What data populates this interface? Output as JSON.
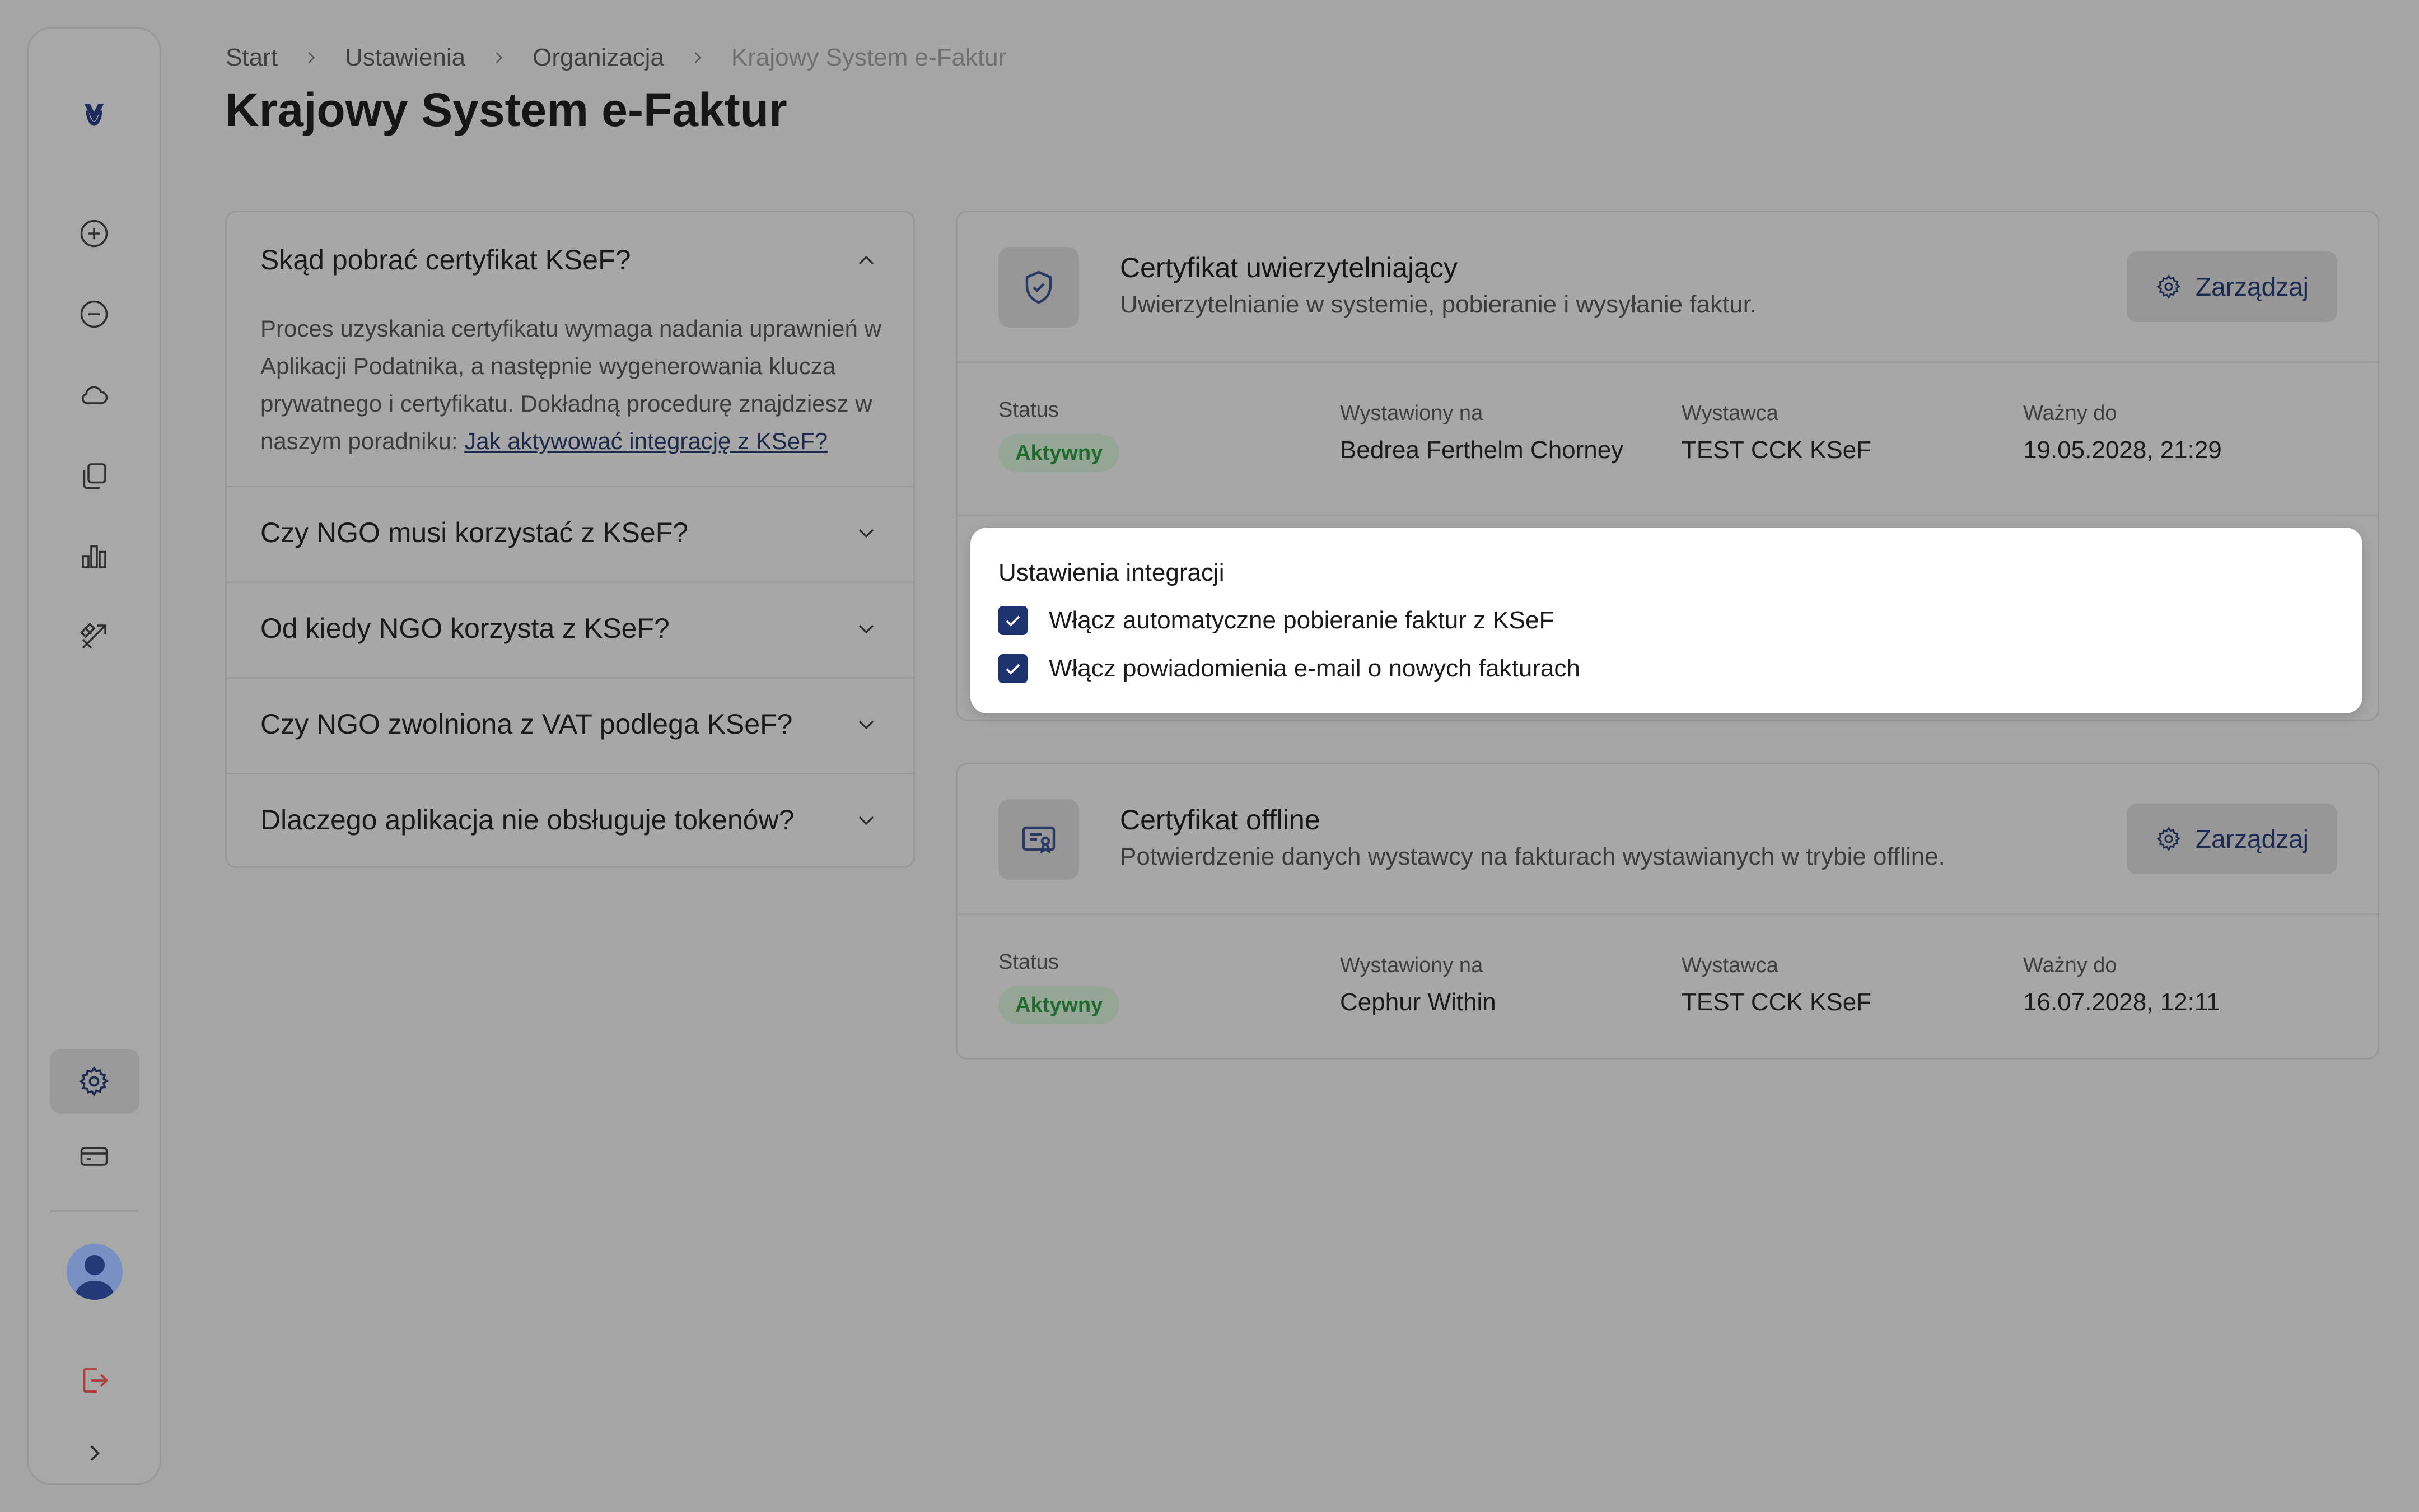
{
  "breadcrumb": {
    "items": [
      "Start",
      "Ustawienia",
      "Organizacja"
    ],
    "current": "Krajowy System e-Faktur"
  },
  "page": {
    "title": "Krajowy System e-Faktur"
  },
  "sidebar": {
    "icons": [
      "logo-icon",
      "plus-circle-icon",
      "minus-circle-icon",
      "cloud-icon",
      "copy-icon",
      "bar-chart-icon",
      "tools-icon",
      "gear-icon",
      "card-icon",
      "user-avatar-icon",
      "logout-icon",
      "chevron-right-icon"
    ],
    "active": "gear-icon",
    "logout_color": "#b23b3b"
  },
  "faq": {
    "items": [
      {
        "question": "Skąd pobrać certyfikat KSeF?",
        "expanded": true,
        "answer": "Proces uzyskania certyfikatu wymaga nadania uprawnień w Aplikacji Podatnika, a następnie wygenerowania klucza prywatnego i certyfikatu. Dokładną procedurę znajdziesz w naszym poradniku: ",
        "link": "Jak aktywować integrację z KSeF?"
      },
      {
        "question": "Czy NGO musi korzystać z KSeF?",
        "expanded": false
      },
      {
        "question": "Od kiedy NGO korzysta z KSeF?",
        "expanded": false
      },
      {
        "question": "Czy NGO zwolniona z VAT podlega KSeF?",
        "expanded": false
      },
      {
        "question": "Dlaczego aplikacja nie obsługuje tokenów?",
        "expanded": false
      }
    ]
  },
  "cards": [
    {
      "title": "Certyfikat uwierzytelniający",
      "subtitle": "Uwierzytelnianie w systemie, pobieranie i wysyłanie faktur.",
      "icon": "shield-check-icon",
      "manage_label": "Zarządzaj",
      "status_label": "Status",
      "status": "Aktywny",
      "issued_to_label": "Wystawiony na",
      "issued_to": "Bedrea Ferthelm Chorney",
      "issuer_label": "Wystawca",
      "issuer": "TEST CCK KSeF",
      "valid_until_label": "Ważny do",
      "valid_until": "19.05.2028, 21:29"
    },
    {
      "title": "Certyfikat offline",
      "subtitle": "Potwierdzenie danych wystawcy na fakturach wystawianych w trybie offline.",
      "icon": "certificate-icon",
      "manage_label": "Zarządzaj",
      "status_label": "Status",
      "status": "Aktywny",
      "issued_to_label": "Wystawiony na",
      "issued_to": "Cephur Within",
      "issuer_label": "Wystawca",
      "issuer": "TEST CCK KSeF",
      "valid_until_label": "Ważny do",
      "valid_until": "16.07.2028, 12:11"
    }
  ],
  "integration": {
    "title": "Ustawienia integracji",
    "options": [
      {
        "label": "Włącz automatyczne pobieranie faktur z KSeF",
        "checked": true
      },
      {
        "label": "Włącz powiadomienia e-mail o nowych fakturach",
        "checked": true
      }
    ]
  },
  "colors": {
    "accent": "#1e3270",
    "status_green": "#1f6b2d",
    "overlay_bg": "#a6a6a6"
  }
}
